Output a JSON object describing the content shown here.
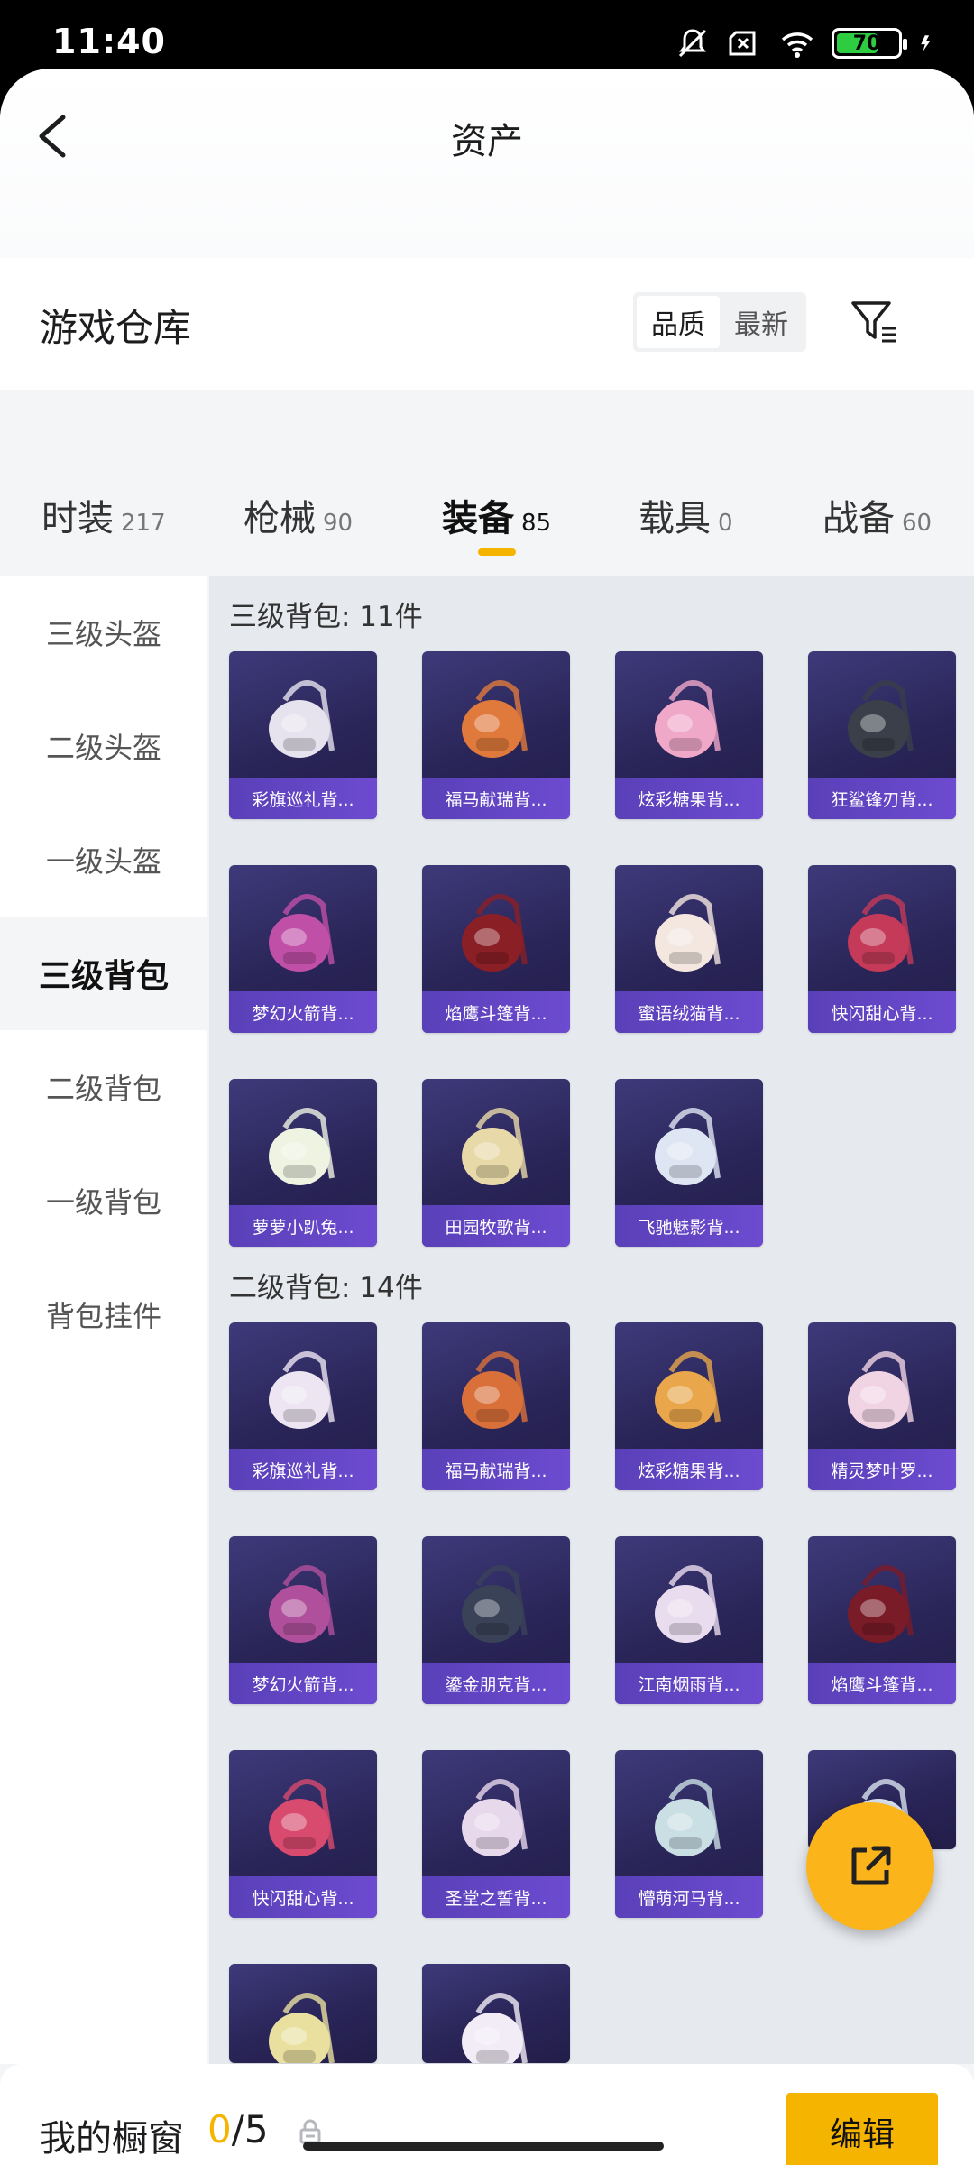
{
  "status_bar": {
    "time": "11:40",
    "battery": "70"
  },
  "header": {
    "title": "资产",
    "back_icon": "chevron-left-icon"
  },
  "warehouse": {
    "title": "游戏仓库",
    "sort_options": [
      "品质",
      "最新"
    ],
    "active_sort": "品质",
    "filter_icon": "filter-icon"
  },
  "tabs": [
    {
      "label": "时装",
      "count": "217"
    },
    {
      "label": "枪械",
      "count": "90"
    },
    {
      "label": "装备",
      "count": "85"
    },
    {
      "label": "载具",
      "count": "0"
    },
    {
      "label": "战备",
      "count": "60"
    }
  ],
  "active_tab": "装备",
  "sidebar": {
    "items": [
      "三级头盔",
      "二级头盔",
      "一级头盔",
      "三级背包",
      "二级背包",
      "一级背包",
      "背包挂件"
    ],
    "active": "三级背包"
  },
  "sections": [
    {
      "title": "三级背包: 11件",
      "items": [
        "彩旗巡礼背...",
        "福马献瑞背...",
        "炫彩糖果背...",
        "狂鲨锋刃背...",
        "梦幻火箭背...",
        "焰鹰斗篷背...",
        "蜜语绒猫背...",
        "快闪甜心背...",
        "萝萝小趴兔...",
        "田园牧歌背...",
        "飞驰魅影背..."
      ]
    },
    {
      "title": "二级背包: 14件",
      "items": [
        "彩旗巡礼背...",
        "福马献瑞背...",
        "炫彩糖果背...",
        "精灵梦叶罗...",
        "梦幻火箭背...",
        "鎏金朋克背...",
        "江南烟雨背...",
        "焰鹰斗篷背...",
        "快闪甜心背...",
        "圣堂之誓背...",
        "懵萌河马背...",
        "",
        "",
        ""
      ]
    }
  ],
  "item_colors": [
    "#e6e2ee",
    "#e07a3c",
    "#f0a8c8",
    "#3a3f4a",
    "#c04fa8",
    "#8a1f26",
    "#f3e7e0",
    "#c43a58",
    "#eef3e2",
    "#e8d9a8",
    "#dfe6f3",
    "#ede6f2",
    "#d9703a",
    "#e9a64a",
    "#f1d4e4",
    "#b0509c",
    "#3a4258",
    "#eadcef",
    "#7a1c28",
    "#d84a6e",
    "#e8d8ec",
    "#c9dfe4",
    "#d8e2ef",
    "#e9e0a0",
    "#f2ecf6"
  ],
  "bottom_bar": {
    "label": "我的橱窗",
    "current": "0",
    "total": "/5",
    "edit_label": "编辑",
    "lock_icon": "lock-icon"
  },
  "fab_icon": "share-icon",
  "accent_color": "#f5b400"
}
